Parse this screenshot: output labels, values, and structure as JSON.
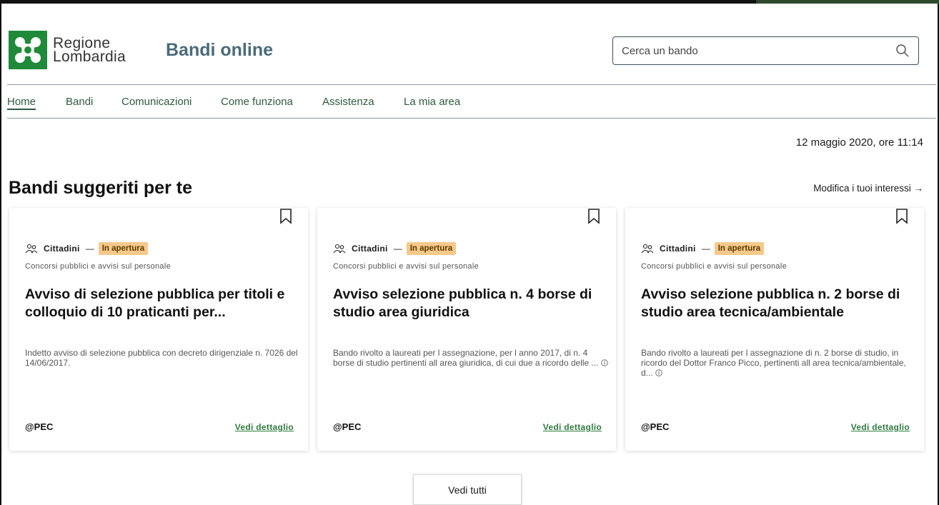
{
  "brand": {
    "logo_line1": "Regione",
    "logo_line2": "Lombardia",
    "app_title": "Bandi online",
    "logo_color": "#1f8a3a"
  },
  "search": {
    "placeholder": "Cerca un bando",
    "icon": "search-icon"
  },
  "nav": {
    "items": [
      {
        "label": "Home",
        "active": true
      },
      {
        "label": "Bandi"
      },
      {
        "label": "Comunicazioni"
      },
      {
        "label": "Come funziona"
      },
      {
        "label": "Assistenza"
      },
      {
        "label": "La mia area"
      }
    ],
    "accent": "#2e5a3e"
  },
  "date_text": "12 maggio 2020, ore 11:14",
  "section": {
    "title": "Bandi suggeriti per te",
    "modify_link": "Modifica i tuoi interessi →"
  },
  "cards": [
    {
      "audience": "Cittadini",
      "dash": "—",
      "status": "In apertura",
      "category": "Concorsi pubblici e avvisi sul personale",
      "title": "Avviso di selezione pubblica per titoli e colloquio di 10 praticanti per...",
      "description": "Indetto avviso di selezione pubblica con decreto dirigenziale n. 7026 del 14/06/2017.",
      "pec": "@PEC",
      "detail_link": "Vedi dettaglio"
    },
    {
      "audience": "Cittadini",
      "dash": "—",
      "status": "In apertura",
      "category": "Concorsi pubblici e avvisi sul personale",
      "title": "Avviso selezione pubblica n. 4 borse di studio area giuridica",
      "description": "Bando rivolto a laureati per l assegnazione, per l anno 2017, di n. 4 borse di studio pertinenti all area giuridica, di cui due a ricordo delle ...",
      "pec": "@PEC",
      "detail_link": "Vedi dettaglio"
    },
    {
      "audience": "Cittadini",
      "dash": "—",
      "status": "In apertura",
      "category": "Concorsi pubblici e avvisi sul personale",
      "title": "Avviso selezione pubblica n. 2 borse di studio area tecnica/ambientale",
      "description": "Bando rivolto a laureati per l assegnazione di n. 2 borse di studio, in ricordo del Dottor Franco Picco, pertinenti all area tecnica/ambientale, d...",
      "pec": "@PEC",
      "detail_link": "Vedi dettaglio"
    }
  ],
  "see_all_label": "Vedi tutti",
  "colors": {
    "status_badge_bg": "#f6c98a",
    "link_green": "#2e7a3e",
    "title_slate": "#4a6b7a"
  }
}
